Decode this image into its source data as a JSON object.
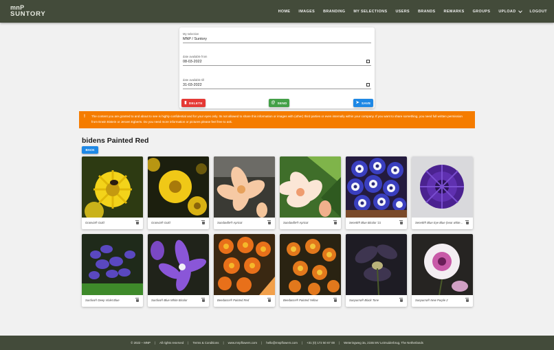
{
  "header": {
    "logo_top": "mnP",
    "logo_bottom": "SUNTORY",
    "nav": [
      "HOME",
      "IMAGES",
      "BRANDING",
      "MY SELECTIONS",
      "USERS",
      "BRANDS",
      "REMARKS",
      "GROUPS",
      "UPLOAD",
      "LOGOUT"
    ]
  },
  "form": {
    "selection_label": "My selection",
    "selection_value": "MNP / Suntory",
    "from_label": "date available from",
    "from_value": "08-03-2022",
    "till_label": "date available till",
    "till_value": "31-03-2022",
    "delete_label": "DELETE",
    "send_label": "SEND",
    "save_label": "SAVE"
  },
  "alert": {
    "icon": "!",
    "text": "The content you are granted to and about to see is highly confidential and for your eyes only. Its not allowed to share this information or images with (other) third parties or even internally within your company. If you want to share something, you need full written permission from Erwin Bistein or Jeroen Egberts. Do you need more information or pictures please feel free to ask."
  },
  "page": {
    "title": "bidens Painted Red",
    "back_label": "BACK"
  },
  "images": [
    {
      "caption": "Granvia® Gold",
      "icon": "flower-photo-yellow-bee"
    },
    {
      "caption": "Granvia® Gold",
      "icon": "flower-photo-yellow"
    },
    {
      "caption": "Sundaville® Apricot",
      "icon": "flower-photo-apricot"
    },
    {
      "caption": "Sundaville® Apricot",
      "icon": "flower-photo-apricot-2"
    },
    {
      "caption": "Senetti® Blue Bicolor '21",
      "icon": "flower-photo-blue-bicolor"
    },
    {
      "caption": "Senetti® Blue Eye Blue (near white 3...",
      "icon": "flower-photo-purple-ball"
    },
    {
      "caption": "Surdiva® Deep Violet Blue",
      "icon": "flower-photo-violet"
    },
    {
      "caption": "Surdiva® Blue White Bicolor",
      "icon": "flower-photo-violet-white"
    },
    {
      "caption": "Beedance® Painted Red",
      "icon": "flower-photo-orange-red"
    },
    {
      "caption": "Beedance® Painted Yellow",
      "icon": "flower-photo-orange-yellow"
    },
    {
      "caption": "Sunpurna® Black Tone",
      "icon": "flower-photo-dark"
    },
    {
      "caption": "Sunpurna® New Purple 2",
      "icon": "flower-photo-pink-white"
    }
  ],
  "footer": {
    "copyright": "© 2022 – MNP",
    "rights": "All rights reserved",
    "terms": "Terms & Conditions",
    "website": "www.mnpflowers.com",
    "email": "hello@mnpflowers.com",
    "phone": "+31 (0) 172 50 67 00",
    "address": "Weteringweg 3a, 2155 MV Leimuiderbrug, The Netherlands"
  }
}
